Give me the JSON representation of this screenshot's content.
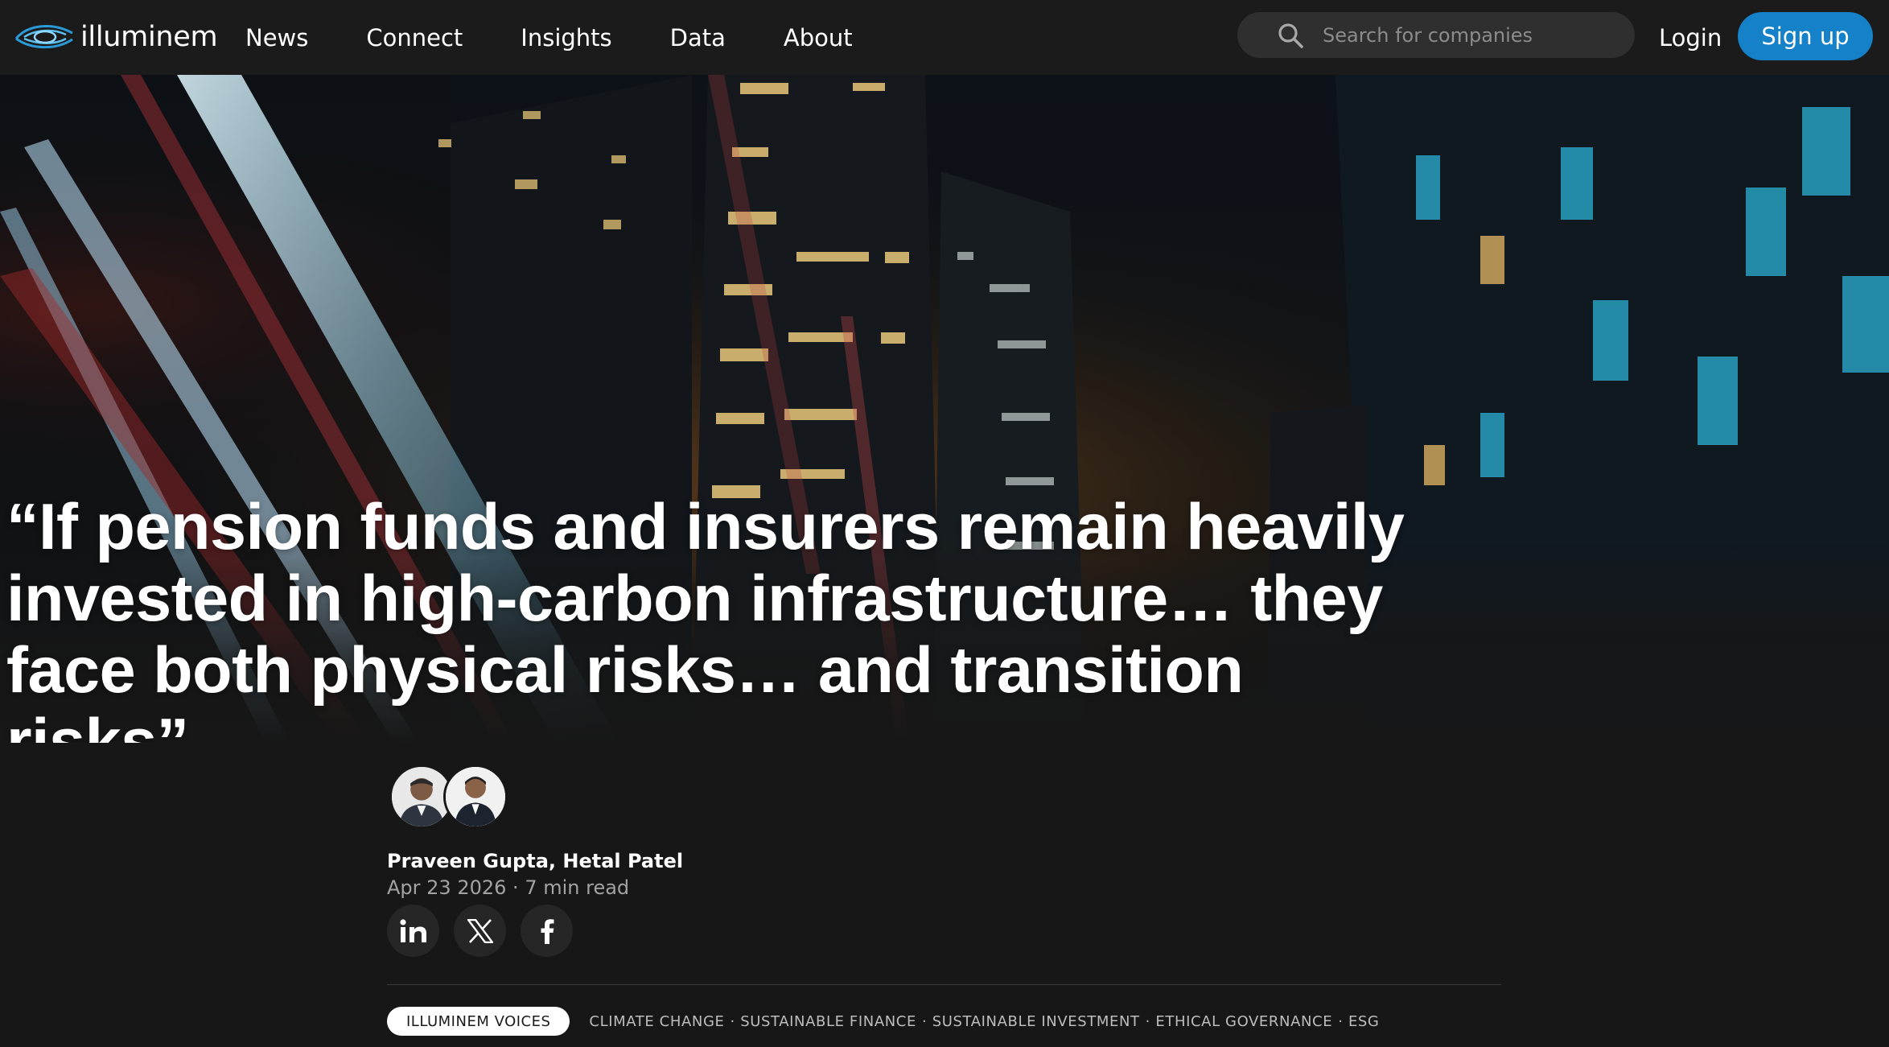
{
  "brand": {
    "name": "illuminem",
    "accent_color": "#1481c8"
  },
  "nav": {
    "items": [
      {
        "label": "News"
      },
      {
        "label": "Connect"
      },
      {
        "label": "Insights"
      },
      {
        "label": "Data"
      },
      {
        "label": "About"
      }
    ],
    "search_placeholder": "Search for companies",
    "login_label": "Login",
    "signup_label": "Sign up"
  },
  "hero": {
    "image": "night-city-skyscrapers-light-trails",
    "headline": "“If pension funds and insurers remain heavily invested in high-carbon infrastructure… they face both physical risks… and transition risks”"
  },
  "article": {
    "authors": "Praveen Gupta, Hetal Patel",
    "date": "Apr 23 2026",
    "separator": "·",
    "read_time": "7 min read",
    "share_icons": [
      "linkedin-icon",
      "x-icon",
      "facebook-icon"
    ],
    "share_glyphs": {
      "linkedin": "in",
      "x": "X",
      "facebook": "f"
    },
    "primary_tag": "ILLUMINEM VOICES",
    "tags": [
      "CLIMATE CHANGE",
      "SUSTAINABLE FINANCE",
      "SUSTAINABLE INVESTMENT",
      "ETHICAL GOVERNANCE",
      "ESG"
    ],
    "tag_separator": "·"
  }
}
